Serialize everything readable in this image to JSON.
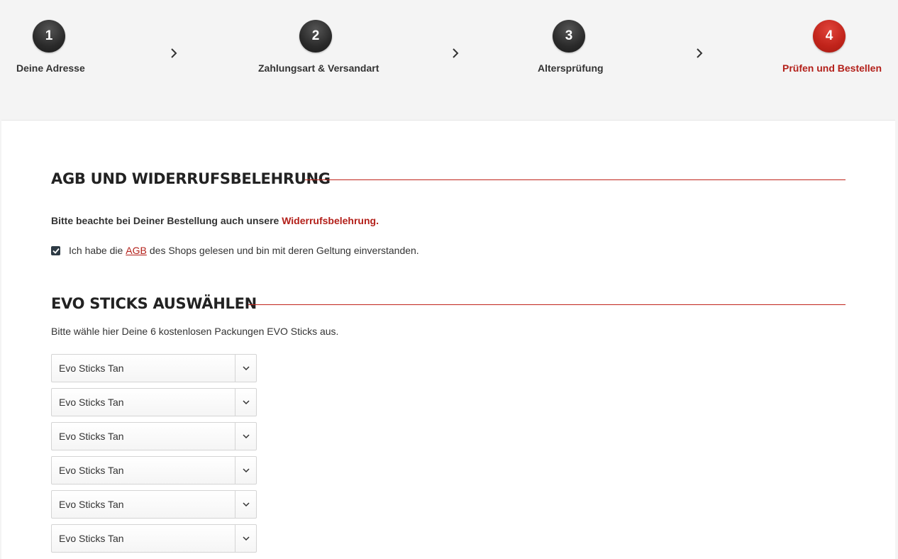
{
  "stepper": {
    "steps": [
      {
        "number": "1",
        "label": "Deine Adresse"
      },
      {
        "number": "2",
        "label": "Zahlungsart & Versandart"
      },
      {
        "number": "3",
        "label": "Altersprüfung"
      },
      {
        "number": "4",
        "label": "Prüfen und Bestellen"
      }
    ],
    "active_step": "4",
    "separator_icon": "chevron-right-icon"
  },
  "agb_section": {
    "title": "AGB UND WIDERRUFSBELEHRUNG",
    "notice_text": "Bitte beachte bei Deiner Bestellung auch unsere ",
    "notice_link": "Widerrufsbelehrung.",
    "checkbox_checked": true,
    "checkbox_text_before": "Ich habe die",
    "checkbox_link": "AGB",
    "checkbox_text_after": "des Shops gelesen und bin mit deren Geltung einverstanden."
  },
  "evo_section": {
    "title": "EVO STICKS AUSWÄHLEN",
    "description": "Bitte wähle hier Deine 6 kostenlosen Packungen EVO Sticks aus.",
    "selects": [
      {
        "value": "Evo Sticks Tan"
      },
      {
        "value": "Evo Sticks Tan"
      },
      {
        "value": "Evo Sticks Tan"
      },
      {
        "value": "Evo Sticks Tan"
      },
      {
        "value": "Evo Sticks Tan"
      },
      {
        "value": "Evo Sticks Tan"
      }
    ]
  },
  "colors": {
    "accent": "#b3201a",
    "step_dark": "#2a2a2a",
    "page_bg": "#f4f4f4"
  }
}
